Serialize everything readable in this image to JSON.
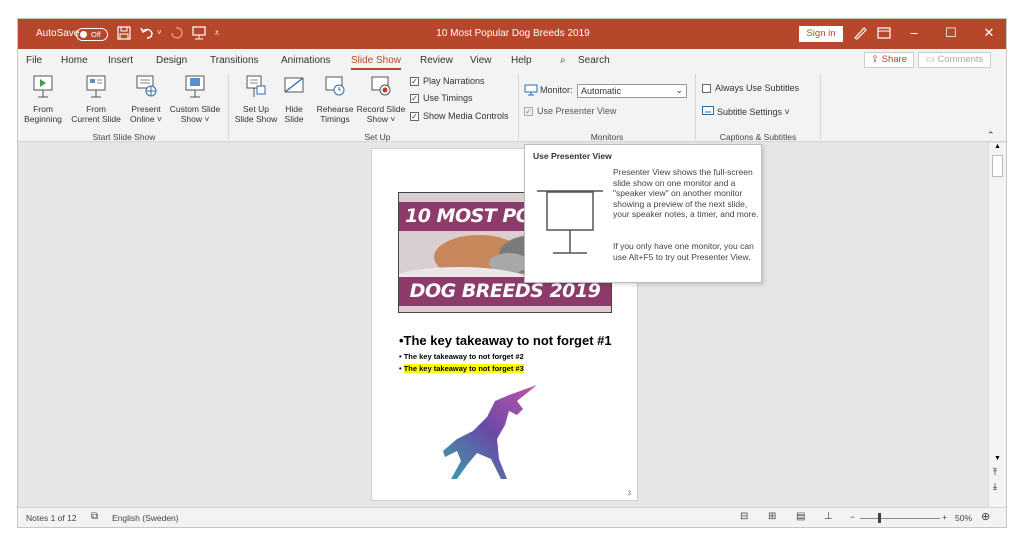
{
  "titlebar": {
    "autosave_label": "AutoSave",
    "autosave_state": "Off",
    "document_title": "10 Most Popular Dog Breeds 2019",
    "sign_in": "Sign in"
  },
  "tabs": [
    "File",
    "Home",
    "Insert",
    "Design",
    "Transitions",
    "Animations",
    "Slide Show",
    "Review",
    "View",
    "Help"
  ],
  "active_tab": "Slide Show",
  "search_label": "Search",
  "share_label": "Share",
  "comments_label": "Comments",
  "ribbon": {
    "start": {
      "from_beginning": [
        "From",
        "Beginning"
      ],
      "from_current": [
        "From",
        "Current Slide"
      ],
      "present_online": [
        "Present",
        "Online ˅"
      ],
      "custom_show": [
        "Custom Slide",
        "Show ˅"
      ],
      "group_label": "Start Slide Show"
    },
    "setup": {
      "setup_show": [
        "Set Up",
        "Slide Show"
      ],
      "hide_slide": [
        "Hide",
        "Slide"
      ],
      "rehearse": [
        "Rehearse",
        "Timings"
      ],
      "record": [
        "Record Slide",
        "Show ˅"
      ],
      "play_narrations": "Play Narrations",
      "use_timings": "Use Timings",
      "show_media": "Show Media Controls",
      "group_label": "Set Up"
    },
    "monitors": {
      "monitor_label": "Monitor:",
      "monitor_value": "Automatic",
      "presenter_view": "Use Presenter View",
      "group_label": "Monitors"
    },
    "captions": {
      "always_subtitles": "Always Use Subtitles",
      "subtitle_settings": "Subtitle Settings ˅",
      "group_label": "Captions & Subtitles"
    }
  },
  "slide": {
    "banner_top": "10 MOST PO",
    "banner_bottom": "DOG BREEDS 2019",
    "bullet1": "•The key takeaway to not forget #1",
    "bullet2": "• The key takeaway to not forget #2",
    "bullet3_prefix": "• ",
    "bullet3": "The key takeaway to not forget #3",
    "page_number": "3"
  },
  "tooltip": {
    "title": "Use Presenter View",
    "para1": "Presenter View shows the full-screen slide show on one monitor and a \"speaker view\" on another monitor showing a preview of the next slide, your speaker notes, a timer, and more.",
    "para2": "If you only have one monitor, you can use Alt+F5 to try out Presenter View."
  },
  "status": {
    "notes": "Notes 1 of 12",
    "language": "English (Sweden)",
    "zoom": "50%",
    "zoom_minus": "−",
    "zoom_plus": "+"
  },
  "colors": {
    "accent": "#b7472a",
    "banner": "#8c3b6b",
    "highlight": "#ffff00"
  }
}
